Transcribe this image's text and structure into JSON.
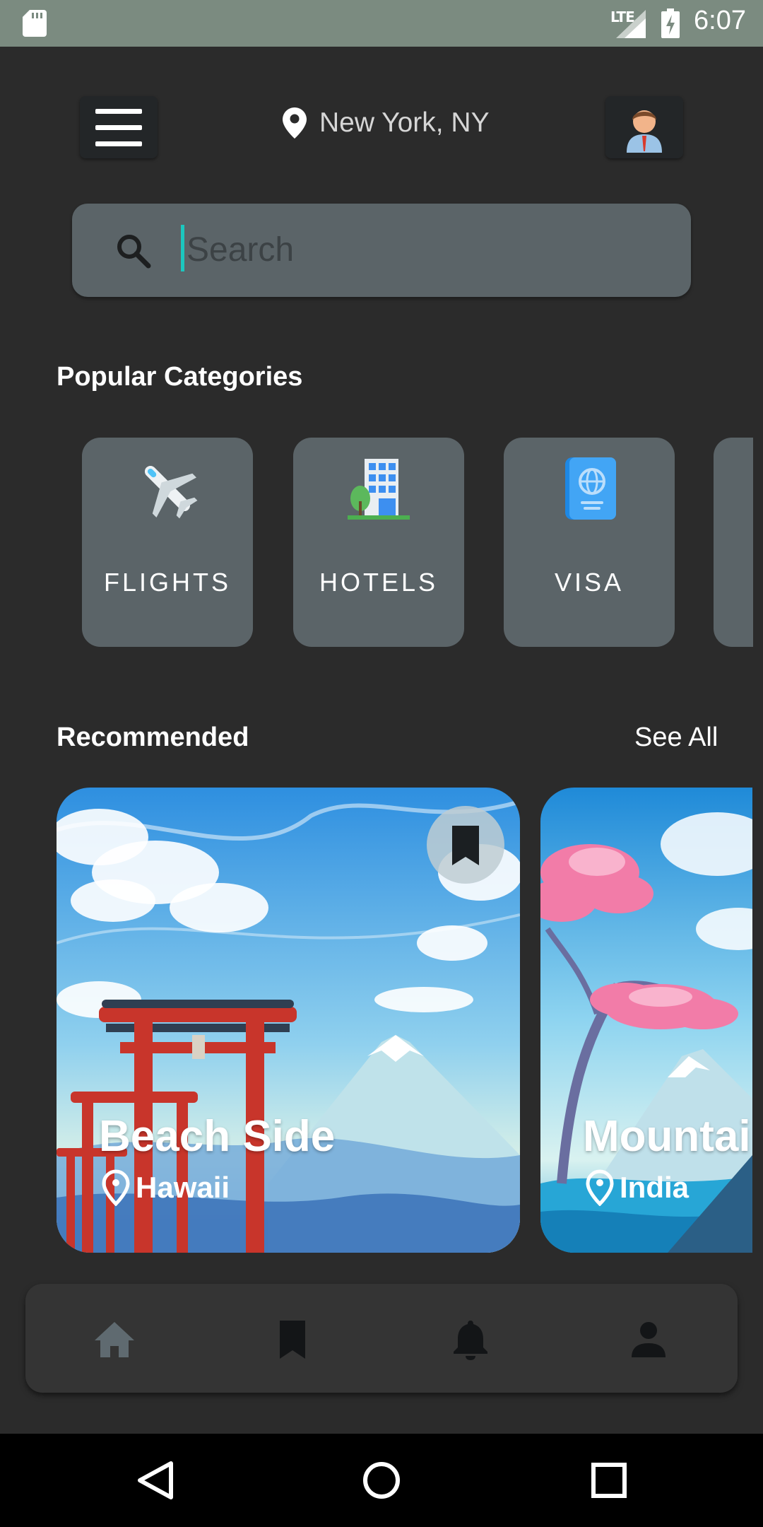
{
  "status_bar": {
    "network": "LTE",
    "time": "6:07"
  },
  "header": {
    "location": "New York, NY"
  },
  "search": {
    "placeholder": "Search"
  },
  "popular_categories": {
    "title": "Popular Categories",
    "items": [
      {
        "label": "FLIGHTS",
        "icon": "airplane-icon"
      },
      {
        "label": "HOTELS",
        "icon": "hotel-icon"
      },
      {
        "label": "VISA",
        "icon": "passport-icon"
      }
    ]
  },
  "recommended": {
    "title": "Recommended",
    "see_all": "See All",
    "cards": [
      {
        "title": "Beach Side",
        "location": "Hawaii"
      },
      {
        "title": "Mountai",
        "location": "India"
      }
    ]
  },
  "bottom_nav": {
    "items": [
      {
        "icon": "home-icon",
        "active": true
      },
      {
        "icon": "bookmark-icon",
        "active": false
      },
      {
        "icon": "bell-icon",
        "active": false
      },
      {
        "icon": "person-icon",
        "active": false
      }
    ]
  },
  "colors": {
    "accent": "#1cc7bf",
    "card": "#5b6468",
    "background": "#2b2b2b"
  }
}
